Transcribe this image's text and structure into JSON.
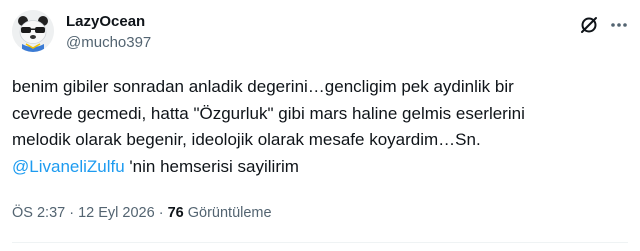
{
  "tweet": {
    "author": {
      "display_name": "LazyOcean",
      "handle": "@mucho397",
      "avatar_icon": "panda-avatar"
    },
    "header_icons": [
      "grok-icon",
      "more-icon"
    ],
    "text_parts": {
      "line1": "benim gibiler sonradan anladik degerini…gencligim pek aydinlik bir",
      "line2": "cevrede gecmedi, hatta \"Özgurluk\" gibi mars haline gelmis eserlerini",
      "line3": "melodik olarak begenir, ideolojik olarak mesafe koyardim…Sn.",
      "mention": "@LivaneliZulfu",
      "after_mention": " 'nin hemserisi sayilirim"
    },
    "meta": {
      "time": "ÖS 2:37",
      "separator": " · ",
      "date": "12 Eyl 2026",
      "views_count": "76",
      "views_label": " Görüntüleme"
    },
    "colors": {
      "text": "#0f1419",
      "secondary": "#536471",
      "link": "#1d9bf0"
    }
  }
}
